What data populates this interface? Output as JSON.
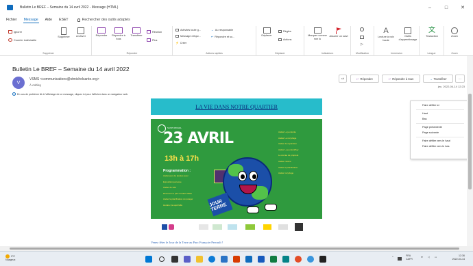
{
  "window": {
    "title": "Bulletin Le BREF – Semaine du 14 avril 2022  -  Message (HTML)",
    "controls": [
      "–",
      "□",
      "✕"
    ]
  },
  "menubar": {
    "items": [
      "Fichier",
      "Message",
      "Aide",
      "ESET"
    ],
    "active": "Message",
    "search": "Rechercher des outils adaptés"
  },
  "ribbon": {
    "supprimer": {
      "ignore": "Ignorer",
      "junk": "Courrier indésirable",
      "delete": "Supprimer",
      "archive": "Archiver",
      "label": "Supprimer"
    },
    "repondre": {
      "reply": "Répondre",
      "reply_all": "Répondre à tous",
      "forward": "Transférer",
      "meeting": "Réunion",
      "more": "Plus",
      "label": "Répondre"
    },
    "actions_rapides": {
      "a": "Activités toute g...",
      "b": "Au responsable",
      "c": "Message d'équi...",
      "d": "Répondre et su...",
      "e": "Créer",
      "label": "Actions rapides"
    },
    "deplacer": {
      "move": "Déplacer",
      "rules": "Règles",
      "actions": "Actions",
      "label": "Déplacer"
    },
    "indicateurs": {
      "mark": "Marquer comme non lu",
      "assign": "Assurer un suivi",
      "label": "Indicateurs"
    },
    "modification": {
      "label": "Modification"
    },
    "immersion": {
      "read": "Lecture à voix haute",
      "tools": "Outils d'apprentissage",
      "label": "Immersion"
    },
    "langue": {
      "translate": "Traduction",
      "label": "Langue"
    },
    "zoom": {
      "zoom": "Zoom",
      "label": "Zoom"
    }
  },
  "message": {
    "subject": "Bulletin Le BREF – Semaine du 14 avril 2022",
    "avatar_initial": "V",
    "sender": "VSMS <communications@stmichelsante.org>",
    "to": "À  Ashley",
    "infobar": "En cas de problème lié à l'affichage de ce message, cliquez ici pour l'afficher dans un navigateur web.",
    "reply": "Répondre",
    "reply_all": "Répondre à tous",
    "forward": "Transférer",
    "more": "···",
    "date": "jeu. 2022-04-14 12:23"
  },
  "newsletter": {
    "section_title": "LA VIE DANS NOTRE QUARTIER",
    "poster": {
      "org": "SAINT-MICHEL",
      "title": "23 AVRIL",
      "time": "13h à 17h",
      "program": "Programmation :",
      "left_items": [
        "Atelier jeux de plantes avec",
        "Exposition jeunesse",
        "Atelier de vélo",
        "Découvrir le parc Frédéric Back",
        "Atelier la planification du potager",
        "Horaire Ça sport/ville"
      ],
      "right_items": [
        "Atelier Le jeu Ecole",
        "Atelier Le recyclage",
        "Atelier de réparation",
        "Atelier Le jeu EcoPlay",
        "La corvée de propreté",
        "Atelier cuisine",
        "Atelier la planification",
        "Atelier recyclage"
      ],
      "jour_text": "JOUR TERRE"
    },
    "caption": "Venez fêter le Jour de la Terre au Parc François-Perrault !"
  },
  "context_menu": {
    "items": [
      "Faire défiler ici",
      "Haut",
      "Bas",
      "Page précédente",
      "Page suivante",
      "Faire défiler vers le haut",
      "Faire défiler vers le bas"
    ]
  },
  "taskbar": {
    "weather_temp": "9°C",
    "weather_text": "Nuageux",
    "lang": "FRA",
    "lang2": "CAFR",
    "time": "12:36",
    "date": "2022-04-14"
  },
  "colors": {
    "accent": "#0f6cbd",
    "poster_green": "#2f9a3e",
    "band": "#27bccb"
  }
}
